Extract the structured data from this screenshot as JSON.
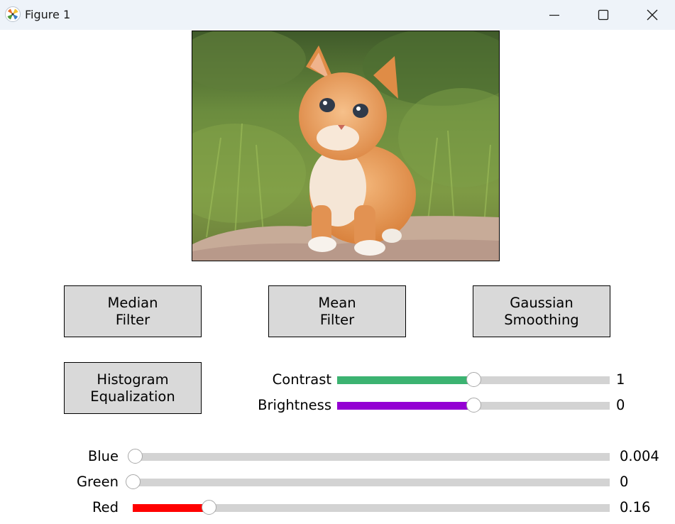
{
  "window": {
    "title": "Figure 1",
    "controls": [
      "minimize-icon",
      "maximize-icon",
      "close-icon"
    ]
  },
  "image": {
    "subject": "orange kitten sitting on a rock in grass"
  },
  "buttons": {
    "median": "Median\nFilter",
    "mean": "Mean\nFilter",
    "gaussian": "Gaussian\nSmoothing",
    "histogram": "Histogram\nEqualization"
  },
  "sliders": {
    "contrast": {
      "label": "Contrast",
      "value": "1",
      "fill_fraction": 0.5,
      "color": "#3cb371"
    },
    "brightness": {
      "label": "Brightness",
      "value": "0",
      "fill_fraction": 0.5,
      "color": "#9400d3"
    },
    "blue": {
      "label": "Blue",
      "value": "0.004",
      "fill_fraction": 0.004,
      "color": "#0000ff"
    },
    "green": {
      "label": "Green",
      "value": "0",
      "fill_fraction": 0.0,
      "color": "#008000"
    },
    "red": {
      "label": "Red",
      "value": "0.16",
      "fill_fraction": 0.16,
      "color": "#ff0000"
    }
  }
}
